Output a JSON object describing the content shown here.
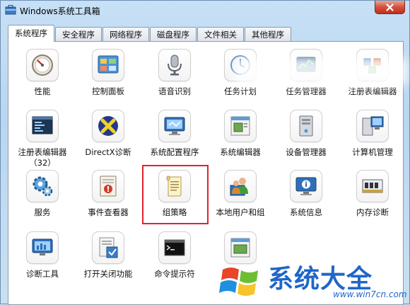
{
  "window": {
    "title": "Windows系统工具箱",
    "close_icon": "close-icon",
    "app_icon": "toolbox-icon"
  },
  "tabs": [
    {
      "label": "系统程序",
      "active": true
    },
    {
      "label": "安全程序",
      "active": false
    },
    {
      "label": "网络程序",
      "active": false
    },
    {
      "label": "磁盘程序",
      "active": false
    },
    {
      "label": "文件相关",
      "active": false
    },
    {
      "label": "其他程序",
      "active": false
    }
  ],
  "tools": [
    {
      "label": "性能",
      "icon": "performance-gauge-icon"
    },
    {
      "label": "控制面板",
      "icon": "control-panel-icon"
    },
    {
      "label": "语音识别",
      "icon": "microphone-icon"
    },
    {
      "label": "任务计划",
      "icon": "task-scheduler-clock-icon"
    },
    {
      "label": "任务管理器",
      "icon": "task-manager-icon"
    },
    {
      "label": "注册表编辑器",
      "icon": "registry-editor-icon"
    },
    {
      "label": "注册表编辑器",
      "label2": "（32）",
      "icon": "registry-editor-32-icon"
    },
    {
      "label": "DirectX诊断",
      "icon": "directx-icon"
    },
    {
      "label": "系统配置程序",
      "icon": "system-config-icon"
    },
    {
      "label": "系统编辑器",
      "icon": "system-editor-icon"
    },
    {
      "label": "设备管理器",
      "icon": "device-manager-icon"
    },
    {
      "label": "计算机管理",
      "icon": "computer-management-icon"
    },
    {
      "label": "服务",
      "icon": "services-gear-icon"
    },
    {
      "label": "事件查看器",
      "icon": "event-viewer-icon"
    },
    {
      "label": "组策略",
      "icon": "group-policy-scroll-icon",
      "highlighted": true
    },
    {
      "label": "本地用户和组",
      "icon": "local-users-icon"
    },
    {
      "label": "系统信息",
      "icon": "system-info-icon"
    },
    {
      "label": "内存诊断",
      "icon": "memory-chip-icon"
    },
    {
      "label": "诊断工具",
      "icon": "diagnostic-tool-icon"
    },
    {
      "label": "打开关闭功能",
      "icon": "windows-features-icon"
    },
    {
      "label": "命令提示符",
      "icon": "command-prompt-icon"
    },
    {
      "label": "",
      "icon": "system-tool-icon"
    }
  ],
  "watermark": {
    "logo": "windows-flag-logo",
    "brand": "系统大全",
    "url": "www.win7cn.com"
  },
  "colors": {
    "highlight": "#e0242a",
    "watermark_blue": "#1f66c9",
    "close_red": "#c0301b"
  }
}
